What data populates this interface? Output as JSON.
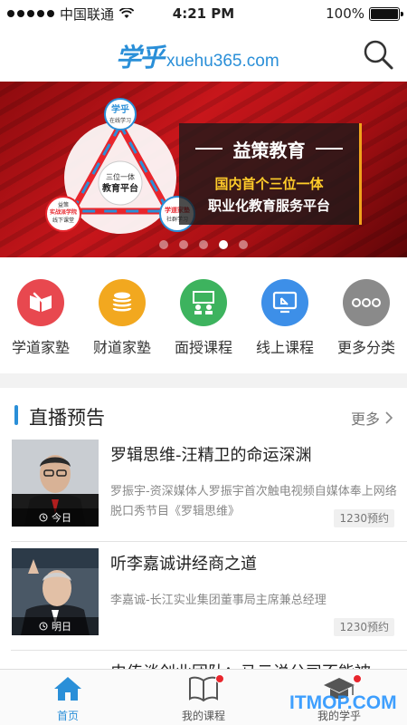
{
  "status": {
    "carrier": "中国联通",
    "time": "4:21 PM",
    "battery": "100%",
    "battery_level": 1.0
  },
  "header": {
    "logo_cn": "学乎",
    "logo_en": "xuehu365.com",
    "icons": {
      "search": "search-icon"
    }
  },
  "banner": {
    "title": "益策教育",
    "subtitle_line1": "国内首个三位一体",
    "subtitle_line2": "职业化教育服务平台",
    "center_line1": "三位一体",
    "center_line2": "教育平台",
    "node_top_title": "学乎",
    "node_top_sub": "在线学习",
    "node_left_line1": "益策",
    "node_left_line2": "实战派学院",
    "node_left_sub": "线下课堂",
    "node_right_title": "学道家塾",
    "node_right_sub": "社群学习",
    "slides": 5,
    "active_slide": 3
  },
  "categories": [
    {
      "label": "学道家塾",
      "icon": "book-icon",
      "color": "#e8484f"
    },
    {
      "label": "财道家塾",
      "icon": "coins-icon",
      "color": "#f2a81f"
    },
    {
      "label": "面授课程",
      "icon": "classroom-icon",
      "color": "#3db35e"
    },
    {
      "label": "线上课程",
      "icon": "screen-icon",
      "color": "#3d8fe8"
    },
    {
      "label": "更多分类",
      "icon": "more-icon",
      "color": "#8a8a8a"
    }
  ],
  "live": {
    "title": "直播预告",
    "more": "更多",
    "items": [
      {
        "title": "罗辑思维-汪精卫的命运深渊",
        "description": "罗振宇-资深媒体人罗振宇首次触电视频自媒体奉上网络脱口秀节目《罗辑思维》",
        "count": "1230预约",
        "tag": "今日"
      },
      {
        "title": "听李嘉诚讲经商之道",
        "description": "李嘉诚-长江实业集团董事局主席兼总经理",
        "count": "1230预约",
        "tag": "明日"
      },
      {
        "title": "史传谈创业团队：马云说公司不能被",
        "description": "",
        "count": "",
        "tag": ""
      }
    ]
  },
  "tabbar": {
    "tabs": [
      {
        "label": "首页",
        "icon": "home-icon",
        "active": true
      },
      {
        "label": "我的课程",
        "icon": "open-book-icon",
        "badge": true
      },
      {
        "label": "我的学乎",
        "icon": "graduation-cap-icon",
        "badge": true
      }
    ]
  },
  "watermark": "ITMOP.COM",
  "colors": {
    "accent": "#2a8fd8",
    "banner_red": "#c8161b",
    "badge": "#e8262d"
  }
}
